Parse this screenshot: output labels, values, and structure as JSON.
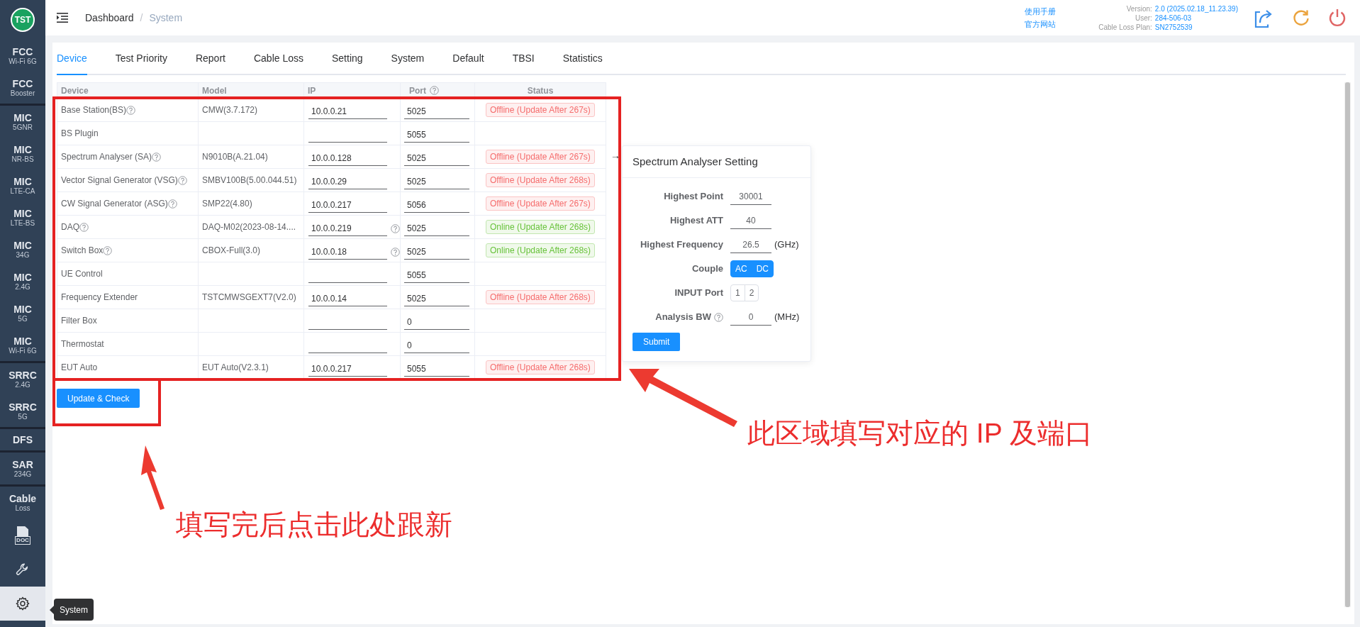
{
  "sidebar": {
    "logo": "TST",
    "groups": [
      {
        "items": [
          {
            "kind": "text",
            "title": "FCC",
            "subtitle": "Wi-Fi 6G",
            "selected": false
          },
          {
            "kind": "text",
            "title": "FCC",
            "subtitle": "Booster",
            "selected": false
          }
        ]
      },
      {
        "items": [
          {
            "kind": "text",
            "title": "MIC",
            "subtitle": "5GNR",
            "selected": false
          },
          {
            "kind": "text",
            "title": "MIC",
            "subtitle": "NR-BS",
            "selected": false
          },
          {
            "kind": "text",
            "title": "MIC",
            "subtitle": "LTE-CA",
            "selected": false
          },
          {
            "kind": "text",
            "title": "MIC",
            "subtitle": "LTE-BS",
            "selected": false
          },
          {
            "kind": "text",
            "title": "MIC",
            "subtitle": "34G",
            "selected": false
          },
          {
            "kind": "text",
            "title": "MIC",
            "subtitle": "2.4G",
            "selected": false
          },
          {
            "kind": "text",
            "title": "MIC",
            "subtitle": "5G",
            "selected": false
          },
          {
            "kind": "text",
            "title": "MIC",
            "subtitle": "Wi-Fi 6G",
            "selected": false
          }
        ]
      },
      {
        "items": [
          {
            "kind": "text",
            "title": "SRRC",
            "subtitle": "2.4G",
            "selected": false
          },
          {
            "kind": "text",
            "title": "SRRC",
            "subtitle": "5G",
            "selected": false
          }
        ]
      },
      {
        "items": [
          {
            "kind": "text",
            "title": "DFS",
            "selected": false
          }
        ]
      },
      {
        "items": [
          {
            "kind": "text",
            "title": "SAR",
            "subtitle": "234G",
            "selected": false
          }
        ]
      },
      {
        "items": [
          {
            "kind": "text",
            "title": "Cable",
            "subtitle": "Loss",
            "selected": false
          },
          {
            "kind": "doc",
            "title": "DOC",
            "selected": false
          },
          {
            "kind": "tool",
            "selected": false
          },
          {
            "kind": "settings",
            "selected": true
          }
        ]
      }
    ],
    "tooltip": "System"
  },
  "header": {
    "breadcrumb": [
      "Dashboard",
      "System"
    ],
    "separator": "/",
    "links": [
      "使用手册",
      "官方网站"
    ],
    "info": [
      {
        "label": "Version:",
        "value": "2.0 (2025.02.18_11.23.39)"
      },
      {
        "label": "User:",
        "value": "284-506-03"
      },
      {
        "label": "Cable Loss Plan:",
        "value": "SN2752539"
      }
    ]
  },
  "tabs": [
    {
      "label": "Device",
      "selected": true
    },
    {
      "label": "Test Priority",
      "selected": false
    },
    {
      "label": "Report",
      "selected": false
    },
    {
      "label": "Cable Loss",
      "selected": false
    },
    {
      "label": "Setting",
      "selected": false
    },
    {
      "label": "System",
      "selected": false
    },
    {
      "label": "Default",
      "selected": false
    },
    {
      "label": "TBSI",
      "selected": false
    },
    {
      "label": "Statistics",
      "selected": false
    }
  ],
  "table": {
    "columns": [
      {
        "label": "Device"
      },
      {
        "label": "Model"
      },
      {
        "label": "IP"
      },
      {
        "label": "Port",
        "help": true
      },
      {
        "label": "Status"
      }
    ],
    "rows": [
      {
        "device": "Base Station(BS)",
        "help": true,
        "model": "CMW(3.7.172)",
        "ip": "10.0.0.21",
        "port": "5025",
        "status": {
          "text": "Offline (Update After 267s)",
          "kind": "offline"
        }
      },
      {
        "device": "BS Plugin",
        "help": false,
        "port": "5055"
      },
      {
        "device": "Spectrum Analyser (SA)",
        "help": true,
        "model": "N9010B(A.21.04)",
        "ip": "10.0.0.128",
        "port": "5025",
        "status": {
          "text": "Offline (Update After 267s)",
          "kind": "offline"
        }
      },
      {
        "device": "Vector Signal Generator (VSG)",
        "help": true,
        "model": "SMBV100B(5.00.044.51)",
        "ip": "10.0.0.29",
        "port": "5025",
        "status": {
          "text": "Offline (Update After 268s)",
          "kind": "offline"
        }
      },
      {
        "device": "CW Signal Generator (ASG)",
        "help": true,
        "model": "SMP22(4.80)",
        "ip": "10.0.0.217",
        "port": "5056",
        "status": {
          "text": "Offline (Update After 267s)",
          "kind": "offline"
        }
      },
      {
        "device": "DAQ",
        "help": true,
        "model": "DAQ-M02(2023-08-14....",
        "ip": "10.0.0.219",
        "ip_help": true,
        "port": "5025",
        "status": {
          "text": "Online (Update After 268s)",
          "kind": "online"
        }
      },
      {
        "device": "Switch Box",
        "help": true,
        "model": "CBOX-Full(3.0)",
        "ip": "10.0.0.18",
        "ip_help": true,
        "port": "5025",
        "status": {
          "text": "Online (Update After 268s)",
          "kind": "online"
        }
      },
      {
        "device": "UE Control",
        "help": false,
        "port": "5055"
      },
      {
        "device": "Frequency Extender",
        "help": false,
        "model": "TSTCMWSGEXT7(V2.0)",
        "ip": "10.0.0.14",
        "port": "5025",
        "status": {
          "text": "Offline (Update After 268s)",
          "kind": "offline"
        }
      },
      {
        "device": "Filter Box",
        "help": false,
        "port": "0"
      },
      {
        "device": "Thermostat",
        "help": false,
        "port": "0"
      },
      {
        "device": "EUT Auto",
        "help": false,
        "model": "EUT Auto(V2.3.1)",
        "ip": "10.0.0.217",
        "port": "5055",
        "status": {
          "text": "Offline (Update After 268s)",
          "kind": "offline"
        }
      }
    ]
  },
  "update_button": "Update & Check",
  "pointer": "→",
  "panel": {
    "title": "Spectrum Analyser Setting",
    "fields": [
      {
        "kind": "input",
        "label": "Highest Point",
        "value": "30001"
      },
      {
        "kind": "input",
        "label": "Highest ATT",
        "value": "40"
      },
      {
        "kind": "input",
        "label": "Highest Frequency",
        "value": "26.5",
        "unit": "(GHz)"
      },
      {
        "kind": "toggle",
        "label": "Couple",
        "options": [
          {
            "label": "AC",
            "selected": true
          },
          {
            "label": "DC",
            "selected": true
          }
        ]
      },
      {
        "kind": "toggle",
        "label": "INPUT Port",
        "options": [
          {
            "label": "1",
            "selected": false
          },
          {
            "label": "2",
            "selected": false
          }
        ]
      },
      {
        "kind": "input",
        "label": "Analysis BW",
        "help": true,
        "value": "0",
        "unit": "(MHz)"
      }
    ],
    "submit": "Submit"
  },
  "annotations": [
    {
      "text": "此区域填写对应的 IP 及端口"
    },
    {
      "text": "填写完后点击此处跟新"
    }
  ]
}
